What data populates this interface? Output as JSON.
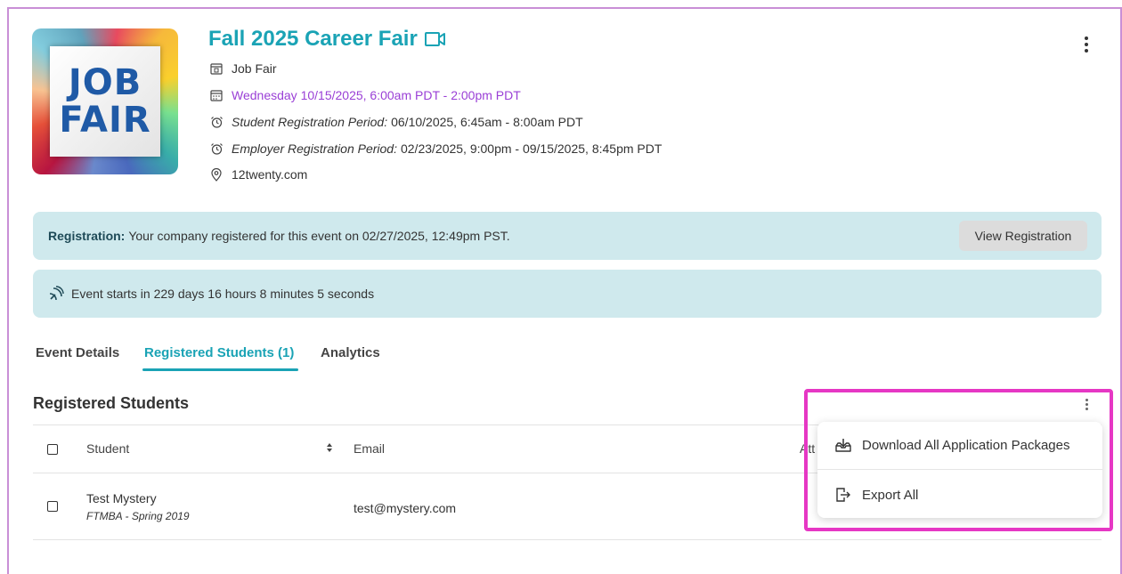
{
  "event": {
    "title": "Fall 2025 Career Fair",
    "logo_line1": "JOB",
    "logo_line2": "FAIR",
    "type": "Job Fair",
    "datetime": "Wednesday 10/15/2025, 6:00am PDT - 2:00pm PDT",
    "student_reg_label": "Student Registration Period:",
    "student_reg_value": "06/10/2025, 6:45am - 8:00am PDT",
    "employer_reg_label": "Employer Registration Period:",
    "employer_reg_value": "02/23/2025, 9:00pm - 09/15/2025, 8:45pm PDT",
    "location": "12twenty.com"
  },
  "registration_banner": {
    "label": "Registration:",
    "text": "Your company registered for this event on 02/27/2025, 12:49pm PST.",
    "button": "View Registration"
  },
  "countdown_banner": {
    "text": "Event starts in 229 days 16 hours 8 minutes 5 seconds"
  },
  "tabs": [
    {
      "label": "Event Details"
    },
    {
      "label": "Registered Students (1)"
    },
    {
      "label": "Analytics"
    }
  ],
  "section": {
    "title": "Registered Students"
  },
  "table": {
    "headers": {
      "student": "Student",
      "email": "Email",
      "partial": "Att"
    },
    "rows": [
      {
        "name": "Test Mystery",
        "program": "FTMBA - Spring 2019",
        "email": "test@mystery.com"
      }
    ]
  },
  "menu": {
    "items": [
      {
        "label": "Download All Application Packages"
      },
      {
        "label": "Export All"
      }
    ]
  },
  "colors": {
    "accent": "#1aa3b5",
    "purple": "#9a3fd6",
    "banner_bg": "#cfe9ed",
    "highlight": "#e637c4"
  }
}
